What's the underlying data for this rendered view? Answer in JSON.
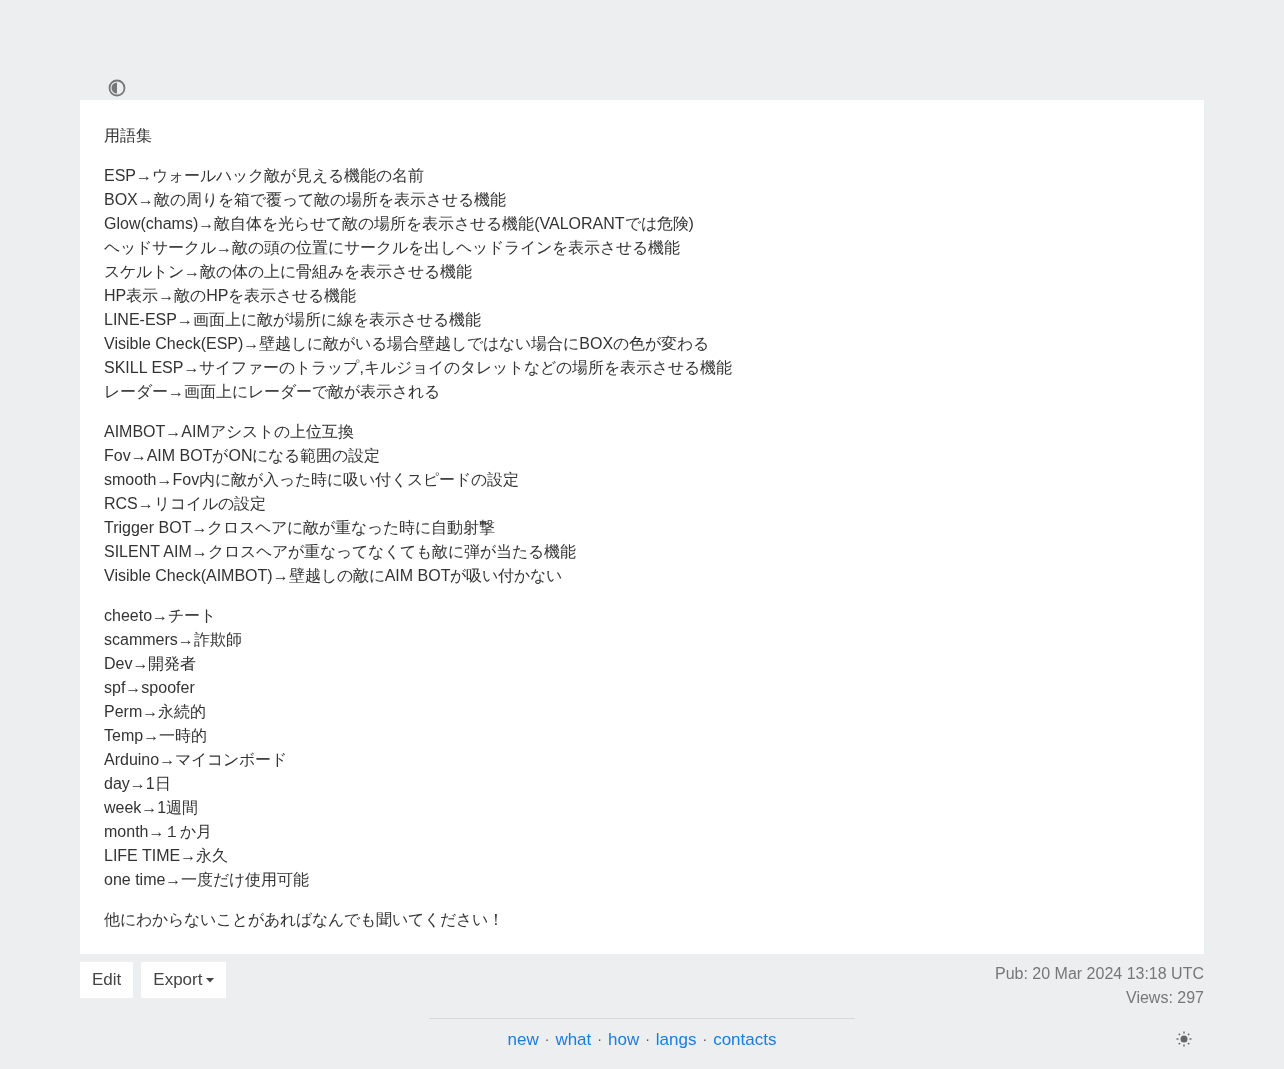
{
  "title": "用語集",
  "groups": [
    [
      "ESP→ウォールハック敵が見える機能の名前",
      "BOX→敵の周りを箱で覆って敵の場所を表示させる機能",
      "Glow(chams)→敵自体を光らせて敵の場所を表示させる機能(VALORANTでは危険)",
      "ヘッドサークル→敵の頭の位置にサークルを出しヘッドラインを表示させる機能",
      "スケルトン→敵の体の上に骨組みを表示させる機能",
      "HP表示→敵のHPを表示させる機能",
      "LINE-ESP→画面上に敵が場所に線を表示させる機能",
      "Visible Check(ESP)→壁越しに敵がいる場合壁越しではない場合にBOXの色が変わる",
      "SKILL ESP→サイファーのトラップ,キルジョイのタレットなどの場所を表示させる機能",
      "レーダー→画面上にレーダーで敵が表示される"
    ],
    [
      "AIMBOT→AIMアシストの上位互換",
      "Fov→AIM BOTがONになる範囲の設定",
      "smooth→Fov内に敵が入った時に吸い付くスピードの設定",
      "RCS→リコイルの設定",
      "Trigger BOT→クロスヘアに敵が重なった時に自動射撃",
      "SILENT AIM→クロスヘアが重なってなくても敵に弾が当たる機能",
      "Visible Check(AIMBOT)→壁越しの敵にAIM BOTが吸い付かない"
    ],
    [
      "cheeto→チート",
      "scammers→詐欺師",
      "Dev→開発者",
      "spf→spoofer",
      "Perm→永続的",
      "Temp→一時的",
      "Arduino→マイコンボード",
      "day→1日",
      "week→1週間",
      "month→１か月",
      "LIFE TIME→永久",
      "one time→一度だけ使用可能"
    ],
    [
      "他にわからないことがあればなんでも聞いてください！"
    ]
  ],
  "buttons": [
    {
      "label": "Edit",
      "kind": "plain"
    },
    {
      "label": "Export",
      "kind": "dropdown"
    }
  ],
  "meta": [
    "Pub: 20 Mar 2024 13:18 UTC",
    "Views: 297"
  ],
  "footer_links": [
    "new",
    "what",
    "how",
    "langs",
    "contacts"
  ],
  "footer_separator": "·"
}
